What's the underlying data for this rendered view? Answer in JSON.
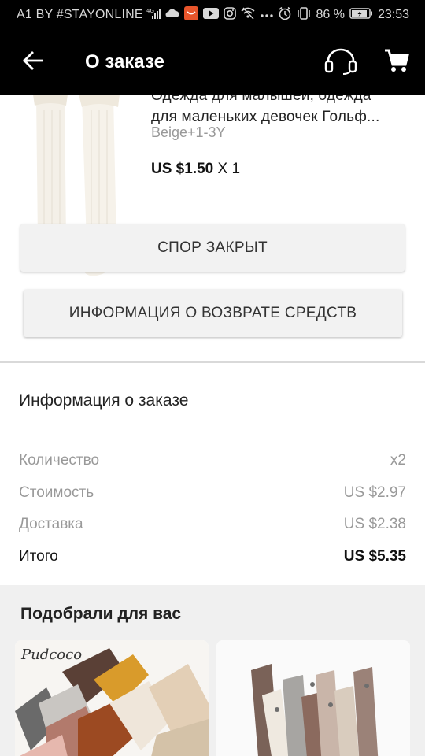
{
  "status_bar": {
    "carrier": "A1 BY #STAYONLINE",
    "battery": "86 %",
    "time": "23:53",
    "icons": [
      "signal-icon",
      "cloud-icon",
      "aliexpress-notification-icon",
      "youtube-icon",
      "instagram-icon",
      "wifi-off-icon",
      "more-dots-icon",
      "alarm-icon",
      "vibrate-icon",
      "battery-icon"
    ]
  },
  "app_bar": {
    "title": "О заказе",
    "icons": [
      "back-arrow-icon",
      "headset-icon",
      "cart-icon"
    ]
  },
  "product": {
    "title_line1": "Одежда для малышей, одежда",
    "title_line2": "для маленьких девочек Гольф...",
    "variant": "Beige+1-3Y",
    "price": "US $1.50",
    "quantity": "X 1"
  },
  "buttons": {
    "dispute": "СПОР ЗАКРЫТ",
    "refund_info": "ИНФОРМАЦИЯ О ВОЗВРАТЕ СРЕДСТВ"
  },
  "order_info": {
    "heading": "Информация о заказе",
    "rows": [
      {
        "label": "Количество",
        "value": "x2"
      },
      {
        "label": "Стоимость",
        "value": "US $2.97"
      },
      {
        "label": "Доставка",
        "value": "US $2.38"
      }
    ],
    "total": {
      "label": "Итого",
      "value": "US $5.35"
    }
  },
  "recommendations": {
    "heading": "Подобрали для вас",
    "card1_brand": "Pudcoco"
  },
  "colors": {
    "bar_bg": "#000000",
    "button_bg": "#f2f2f2",
    "muted_text": "#999999",
    "section_bg": "#f0f0f0"
  }
}
